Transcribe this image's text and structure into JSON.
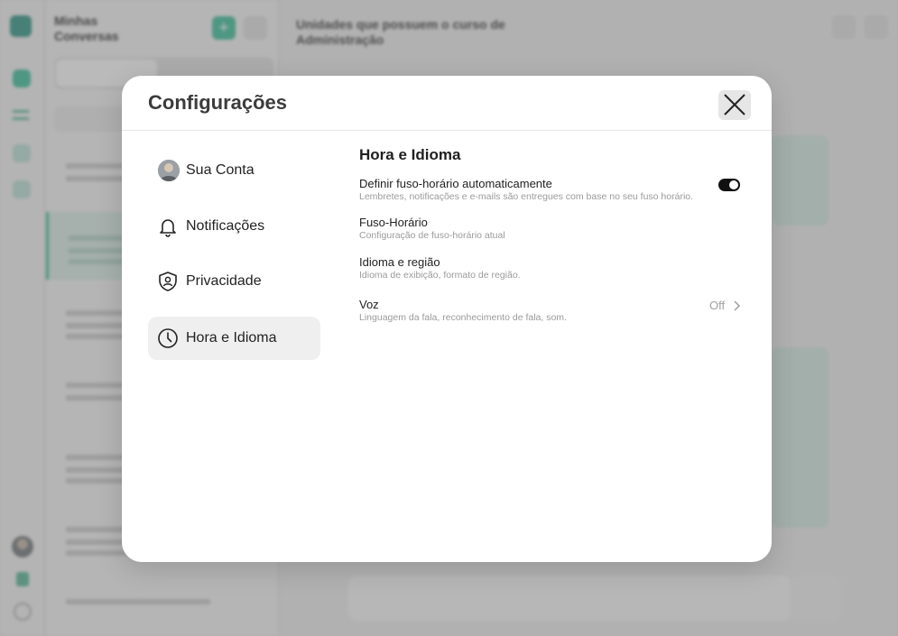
{
  "modal": {
    "title": "Configurações",
    "nav": [
      {
        "label": "Sua Conta"
      },
      {
        "label": "Notificações"
      },
      {
        "label": "Privacidade"
      },
      {
        "label": "Hora e Idioma"
      }
    ],
    "section_title": "Hora e Idioma",
    "settings": [
      {
        "label": "Definir fuso-horário automaticamente",
        "description": "Lembretes, notificações e e-mails são entregues com base no seu fuso horário.",
        "toggle_on": true
      },
      {
        "label": "Fuso-Horário",
        "description": "Configuração de fuso-horário atual"
      },
      {
        "label": "Idioma e região",
        "description": "Idioma de exibição, formato de região."
      },
      {
        "label": "Voz",
        "description": "Linguagem da fala, reconhecimento de fala, som.",
        "value": "Off"
      }
    ]
  },
  "background": {
    "conversations_title": "Minhas Conversas",
    "chat_title": "Unidades que possuem o curso de Administração",
    "accent_color": "#46c39f"
  }
}
